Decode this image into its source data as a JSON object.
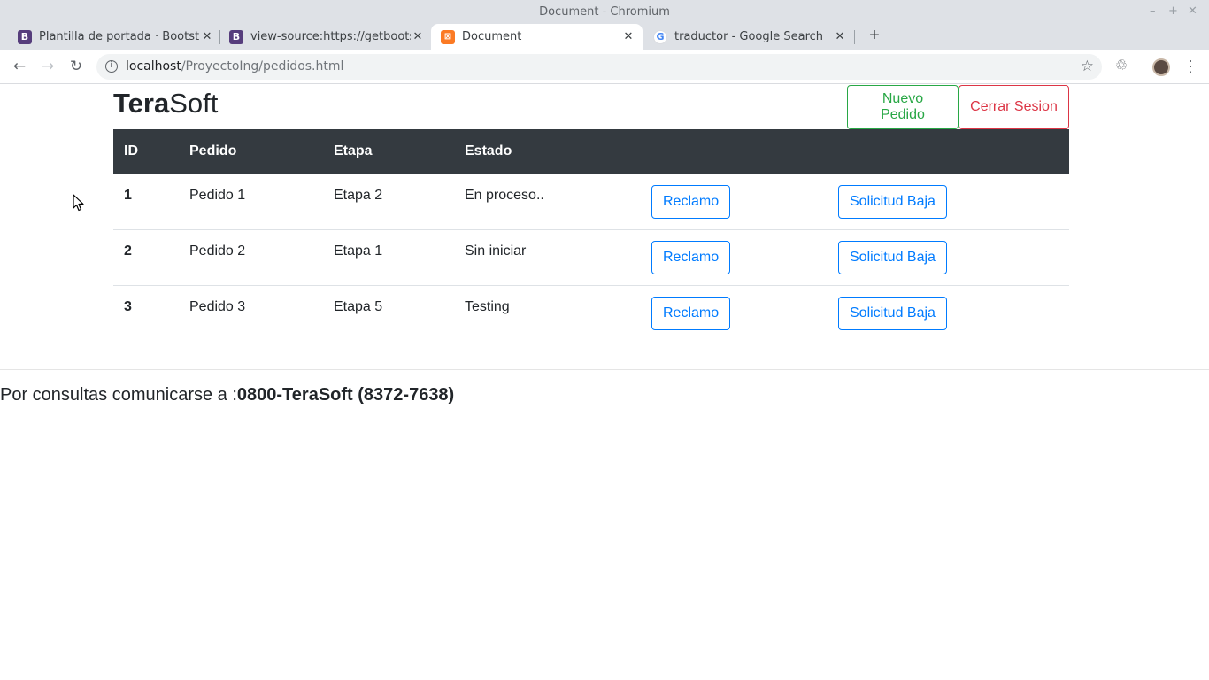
{
  "window": {
    "title": "Document - Chromium"
  },
  "tabs": [
    {
      "title": "Plantilla de portada · Bootstra",
      "favicon": "B",
      "favicon_color": "#563d7c",
      "active": false
    },
    {
      "title": "view-source:https://getbootst",
      "favicon": "B",
      "favicon_color": "#563d7c",
      "active": false
    },
    {
      "title": "Document",
      "favicon": "xampp-icon",
      "favicon_color": "#fb7a24",
      "active": true
    },
    {
      "title": "traductor - Google Search",
      "favicon": "G",
      "favicon_color": "#4285f4",
      "active": false
    }
  ],
  "address": {
    "host": "localhost",
    "path": "/ProyectoIng/pedidos.html"
  },
  "page": {
    "brand_bold": "Tera",
    "brand_rest": "Soft",
    "new_order_button": "Nuevo Pedido",
    "logout_button": "Cerrar Sesion",
    "table": {
      "headers": [
        "ID",
        "Pedido",
        "Etapa",
        "Estado"
      ],
      "rows": [
        {
          "id": "1",
          "order": "Pedido 1",
          "stage": "Etapa 2",
          "status": "En proceso..",
          "claim": "Reclamo",
          "cancel": "Solicitud Baja"
        },
        {
          "id": "2",
          "order": "Pedido 2",
          "stage": "Etapa 1",
          "status": "Sin iniciar",
          "claim": "Reclamo",
          "cancel": "Solicitud Baja"
        },
        {
          "id": "3",
          "order": "Pedido 3",
          "stage": "Etapa 5",
          "status": "Testing",
          "claim": "Reclamo",
          "cancel": "Solicitud Baja"
        }
      ]
    },
    "footer_text": "Por consultas comunicarse a :",
    "footer_phone": "0800-TeraSoft (8372-7638)"
  },
  "colors": {
    "success": "#28a745",
    "danger": "#dc3545",
    "primary": "#007bff",
    "table_header": "#343a40"
  }
}
